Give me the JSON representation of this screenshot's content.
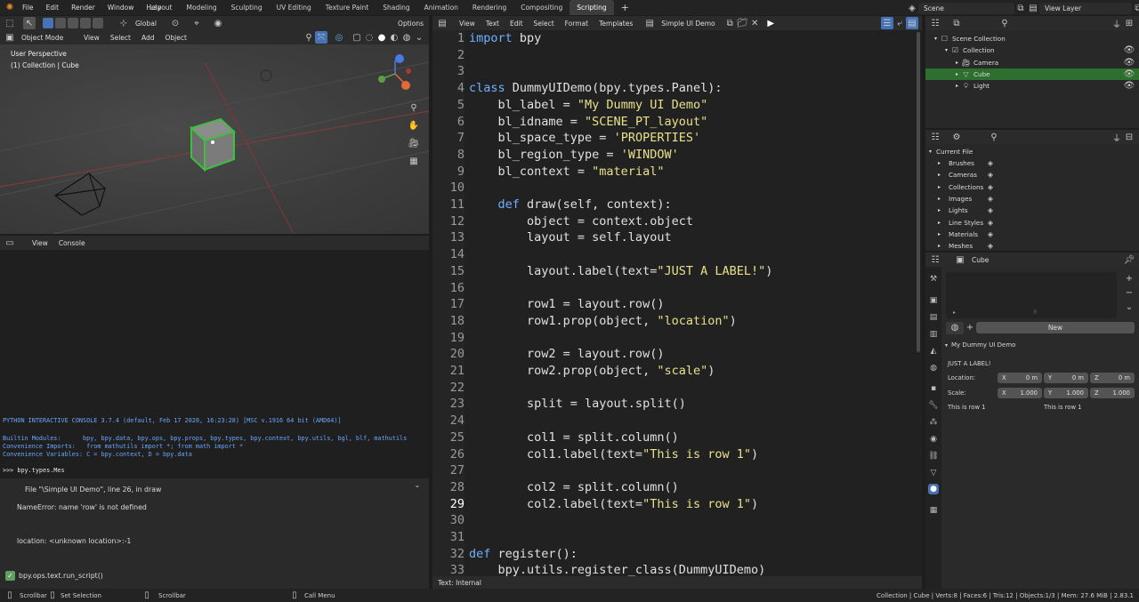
{
  "topbar": {
    "menu": [
      "File",
      "Edit",
      "Render",
      "Window",
      "Help"
    ],
    "workspaces": [
      "Layout",
      "Modeling",
      "Sculpting",
      "UV Editing",
      "Texture Paint",
      "Shading",
      "Animation",
      "Rendering",
      "Compositing",
      "Scripting"
    ],
    "active_workspace": "Scripting",
    "scene": "Scene",
    "view_layer": "View Layer"
  },
  "viewport": {
    "mode": "Object Mode",
    "menus": [
      "View",
      "Select",
      "Add",
      "Object"
    ],
    "orientation": "Global",
    "options_label": "Options",
    "overlay_title": "User Perspective",
    "overlay_subtitle": "(1) Collection | Cube"
  },
  "console": {
    "menus": [
      "View",
      "Console"
    ],
    "banner": "PYTHON INTERACTIVE CONSOLE 3.7.4 (default, Feb 17 2020, 16:23:28) [MSC v.1916 64 bit (AMD64)]",
    "builtin": "Builtin Modules:      bpy, bpy.data, bpy.ops, bpy.props, bpy.types, bpy.context, bpy.utils, bgl, blf, mathutils",
    "imports": "Convenience Imports:   from mathutils import *; from math import *",
    "variables": "Convenience Variables: C = bpy.context, D = bpy.data",
    "prompt": ">>> bpy.types.Mes"
  },
  "report": {
    "line1": "File \"\\Simple UI Demo\", line 26, in draw",
    "line2": "NameError: name 'row' is not defined",
    "line3": "location: <unknown location>:-1",
    "operator": "bpy.ops.text.run_script()"
  },
  "text_editor": {
    "menus": [
      "View",
      "Text",
      "Edit",
      "Select",
      "Format",
      "Templates"
    ],
    "file_name": "Simple UI Demo",
    "footer": "Text: Internal",
    "current_line": 29,
    "lines": [
      {
        "n": "1",
        "segs": [
          [
            "kw",
            "import"
          ],
          [
            "p",
            " bpy"
          ]
        ]
      },
      {
        "n": "2",
        "segs": []
      },
      {
        "n": "3",
        "segs": []
      },
      {
        "n": "4",
        "segs": [
          [
            "kw",
            "class"
          ],
          [
            "p",
            " DummyUIDemo(bpy.types.Panel):"
          ]
        ]
      },
      {
        "n": "5",
        "segs": [
          [
            "p",
            "    bl_label = "
          ],
          [
            "str",
            "\"My Dummy UI Demo\""
          ]
        ]
      },
      {
        "n": "6",
        "segs": [
          [
            "p",
            "    bl_idname = "
          ],
          [
            "str",
            "\"SCENE_PT_layout\""
          ]
        ]
      },
      {
        "n": "7",
        "segs": [
          [
            "p",
            "    bl_space_type = "
          ],
          [
            "str",
            "'PROPERTIES'"
          ]
        ]
      },
      {
        "n": "8",
        "segs": [
          [
            "p",
            "    bl_region_type = "
          ],
          [
            "str",
            "'WINDOW'"
          ]
        ]
      },
      {
        "n": "9",
        "segs": [
          [
            "p",
            "    bl_context = "
          ],
          [
            "str",
            "\"material\""
          ]
        ]
      },
      {
        "n": "10",
        "segs": []
      },
      {
        "n": "11",
        "segs": [
          [
            "p",
            "    "
          ],
          [
            "kw",
            "def"
          ],
          [
            "p",
            " draw(self, context):"
          ]
        ]
      },
      {
        "n": "12",
        "segs": [
          [
            "p",
            "        object = context.object"
          ]
        ]
      },
      {
        "n": "13",
        "segs": [
          [
            "p",
            "        layout = self.layout"
          ]
        ]
      },
      {
        "n": "14",
        "segs": []
      },
      {
        "n": "15",
        "segs": [
          [
            "p",
            "        layout.label(text="
          ],
          [
            "str",
            "\"JUST A LABEL!\""
          ],
          [
            "p",
            ")"
          ]
        ]
      },
      {
        "n": "16",
        "segs": []
      },
      {
        "n": "17",
        "segs": [
          [
            "p",
            "        row1 = layout.row()"
          ]
        ]
      },
      {
        "n": "18",
        "segs": [
          [
            "p",
            "        row1.prop(object, "
          ],
          [
            "str",
            "\"location\""
          ],
          [
            "p",
            ")"
          ]
        ]
      },
      {
        "n": "19",
        "segs": []
      },
      {
        "n": "20",
        "segs": [
          [
            "p",
            "        row2 = layout.row()"
          ]
        ]
      },
      {
        "n": "21",
        "segs": [
          [
            "p",
            "        row2.prop(object, "
          ],
          [
            "str",
            "\"scale\""
          ],
          [
            "p",
            ")"
          ]
        ]
      },
      {
        "n": "22",
        "segs": []
      },
      {
        "n": "23",
        "segs": [
          [
            "p",
            "        split = layout.split()"
          ]
        ]
      },
      {
        "n": "24",
        "segs": []
      },
      {
        "n": "25",
        "segs": [
          [
            "p",
            "        col1 = split.column()"
          ]
        ]
      },
      {
        "n": "26",
        "segs": [
          [
            "p",
            "        col1.label(text="
          ],
          [
            "str",
            "\"This is row 1\""
          ],
          [
            "p",
            ")"
          ]
        ]
      },
      {
        "n": "27",
        "segs": []
      },
      {
        "n": "28",
        "segs": [
          [
            "p",
            "        col2 = split.column()"
          ]
        ]
      },
      {
        "n": "29",
        "segs": [
          [
            "p",
            "        col2.label(text="
          ],
          [
            "str",
            "\"This is row 1\""
          ],
          [
            "p",
            ")"
          ]
        ]
      },
      {
        "n": "30",
        "segs": []
      },
      {
        "n": "31",
        "segs": []
      },
      {
        "n": "32",
        "segs": [
          [
            "kw",
            "def"
          ],
          [
            "p",
            " register():"
          ]
        ]
      },
      {
        "n": "33",
        "segs": [
          [
            "p",
            "    bpy.utils.register_class(DummyUIDemo)"
          ]
        ]
      }
    ]
  },
  "outliner": {
    "items": [
      {
        "label": "Scene Collection",
        "indent": 0,
        "selected": false
      },
      {
        "label": "Collection",
        "indent": 1,
        "selected": false
      },
      {
        "label": "Camera",
        "indent": 2,
        "selected": false
      },
      {
        "label": "Cube",
        "indent": 2,
        "selected": true
      },
      {
        "label": "Light",
        "indent": 2,
        "selected": false
      }
    ]
  },
  "data_browser": {
    "root": "Current File",
    "items": [
      "Brushes",
      "Cameras",
      "Collections",
      "Images",
      "Lights",
      "Line Styles",
      "Materials",
      "Meshes"
    ]
  },
  "properties": {
    "object_name": "Cube",
    "new_button": "New",
    "panel_title": "My Dummy UI Demo",
    "label": "JUST A LABEL!",
    "location_label": "Location:",
    "scale_label": "Scale:",
    "location": {
      "x": "0 m",
      "y": "0 m",
      "z": "0 m"
    },
    "scale": {
      "x": "1.000",
      "y": "1.000",
      "z": "1.000"
    },
    "axis": {
      "x": "X",
      "y": "Y",
      "z": "Z"
    },
    "row_text_1": "This is row 1",
    "row_text_2": "This is row 1"
  },
  "statusbar": {
    "items": [
      "Scrollbar",
      "Set Selection",
      "Scrollbar",
      "Call Menu"
    ],
    "right": "Collection | Cube | Verts:8 | Faces:6 | Tris:12 | Objects:1/3 | Mem: 27.6 MiB | 2.83.1"
  }
}
